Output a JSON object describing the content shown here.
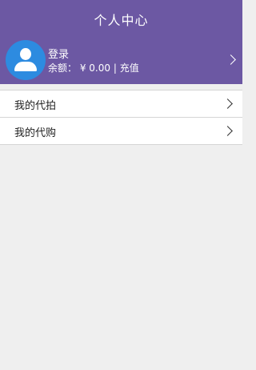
{
  "header": {
    "title": "个人中心"
  },
  "profile": {
    "login_label": "登录",
    "balance_prefix": "余额：",
    "balance_value": "¥ 0.00",
    "separator": "|",
    "recharge_label": "充值"
  },
  "menu": {
    "items": [
      {
        "label": "我的代拍"
      },
      {
        "label": "我的代购"
      }
    ]
  },
  "colors": {
    "header_bg": "#6c58a3",
    "avatar_bg": "#2d8be0",
    "page_bg": "#efefef"
  }
}
